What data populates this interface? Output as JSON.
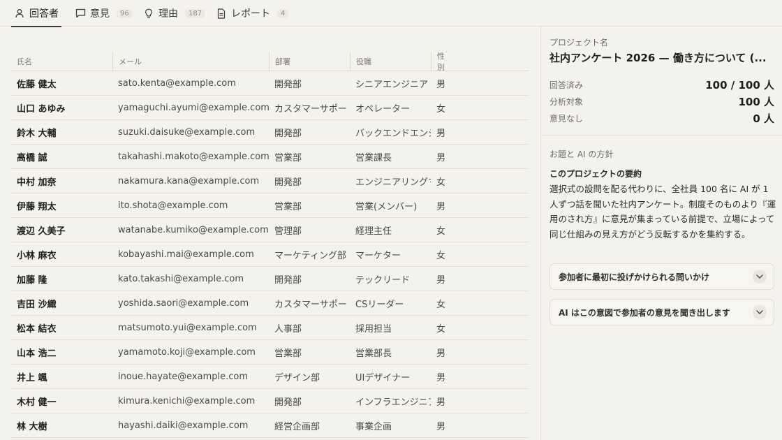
{
  "tabs": [
    {
      "label": "回答者",
      "count": "",
      "icon": "user-icon"
    },
    {
      "label": "意見",
      "count": "96",
      "icon": "comment-icon"
    },
    {
      "label": "理由",
      "count": "187",
      "icon": "lightbulb-icon"
    },
    {
      "label": "レポート",
      "count": "4",
      "icon": "document-icon"
    }
  ],
  "table": {
    "columns": [
      "氏名",
      "メール",
      "部署",
      "役職",
      "性別"
    ],
    "rows": [
      {
        "name": "佐藤 健太",
        "email": "sato.kenta@example.com",
        "dept": "開発部",
        "role": "シニアエンジニア",
        "gender": "男"
      },
      {
        "name": "山口 あゆみ",
        "email": "yamaguchi.ayumi@example.com",
        "dept": "カスタマーサポート",
        "role": "オペレーター",
        "gender": "女"
      },
      {
        "name": "鈴木 大輔",
        "email": "suzuki.daisuke@example.com",
        "dept": "開発部",
        "role": "バックエンドエンジニア",
        "gender": "男"
      },
      {
        "name": "高橋 誠",
        "email": "takahashi.makoto@example.com",
        "dept": "営業部",
        "role": "営業課長",
        "gender": "男"
      },
      {
        "name": "中村 加奈",
        "email": "nakamura.kana@example.com",
        "dept": "開発部",
        "role": "エンジニアリングマネージャー",
        "gender": "女"
      },
      {
        "name": "伊藤 翔太",
        "email": "ito.shota@example.com",
        "dept": "営業部",
        "role": "営業(メンバー)",
        "gender": "男"
      },
      {
        "name": "渡辺 久美子",
        "email": "watanabe.kumiko@example.com",
        "dept": "管理部",
        "role": "経理主任",
        "gender": "女"
      },
      {
        "name": "小林 麻衣",
        "email": "kobayashi.mai@example.com",
        "dept": "マーケティング部",
        "role": "マーケター",
        "gender": "女"
      },
      {
        "name": "加藤 隆",
        "email": "kato.takashi@example.com",
        "dept": "開発部",
        "role": "テックリード",
        "gender": "男"
      },
      {
        "name": "吉田 沙織",
        "email": "yoshida.saori@example.com",
        "dept": "カスタマーサポート",
        "role": "CSリーダー",
        "gender": "女"
      },
      {
        "name": "松本 結衣",
        "email": "matsumoto.yui@example.com",
        "dept": "人事部",
        "role": "採用担当",
        "gender": "女"
      },
      {
        "name": "山本 浩二",
        "email": "yamamoto.koji@example.com",
        "dept": "営業部",
        "role": "営業部長",
        "gender": "男"
      },
      {
        "name": "井上 颯",
        "email": "inoue.hayate@example.com",
        "dept": "デザイン部",
        "role": "UIデザイナー",
        "gender": "男"
      },
      {
        "name": "木村 健一",
        "email": "kimura.kenichi@example.com",
        "dept": "開発部",
        "role": "インフラエンジニア",
        "gender": "男"
      },
      {
        "name": "林 大樹",
        "email": "hayashi.daiki@example.com",
        "dept": "経営企画部",
        "role": "事業企画",
        "gender": "男"
      }
    ]
  },
  "panel": {
    "project_label": "プロジェクト名",
    "project_title": "社内アンケート 2026 — 働き方について (...",
    "stats": [
      {
        "label": "回答済み",
        "value": "100 / 100 人"
      },
      {
        "label": "分析対象",
        "value": "100 人"
      },
      {
        "label": "意見なし",
        "value": "0 人"
      }
    ],
    "section_title": "お題と AI の方針",
    "summary_title": "このプロジェクトの要約",
    "summary_body": "選択式の設問を配る代わりに、全社員 100 名に AI が 1 人ずつ話を聞いた社内アンケート。制度そのものより『運用のされ方』に意見が集まっている前提で、立場によって同じ仕組みの見え方がどう反転するかを集約する。",
    "accordions": [
      {
        "label": "参加者に最初に投げかけられる問いかけ"
      },
      {
        "label": "AI はこの意図で参加者の意見を聞き出します"
      }
    ]
  }
}
